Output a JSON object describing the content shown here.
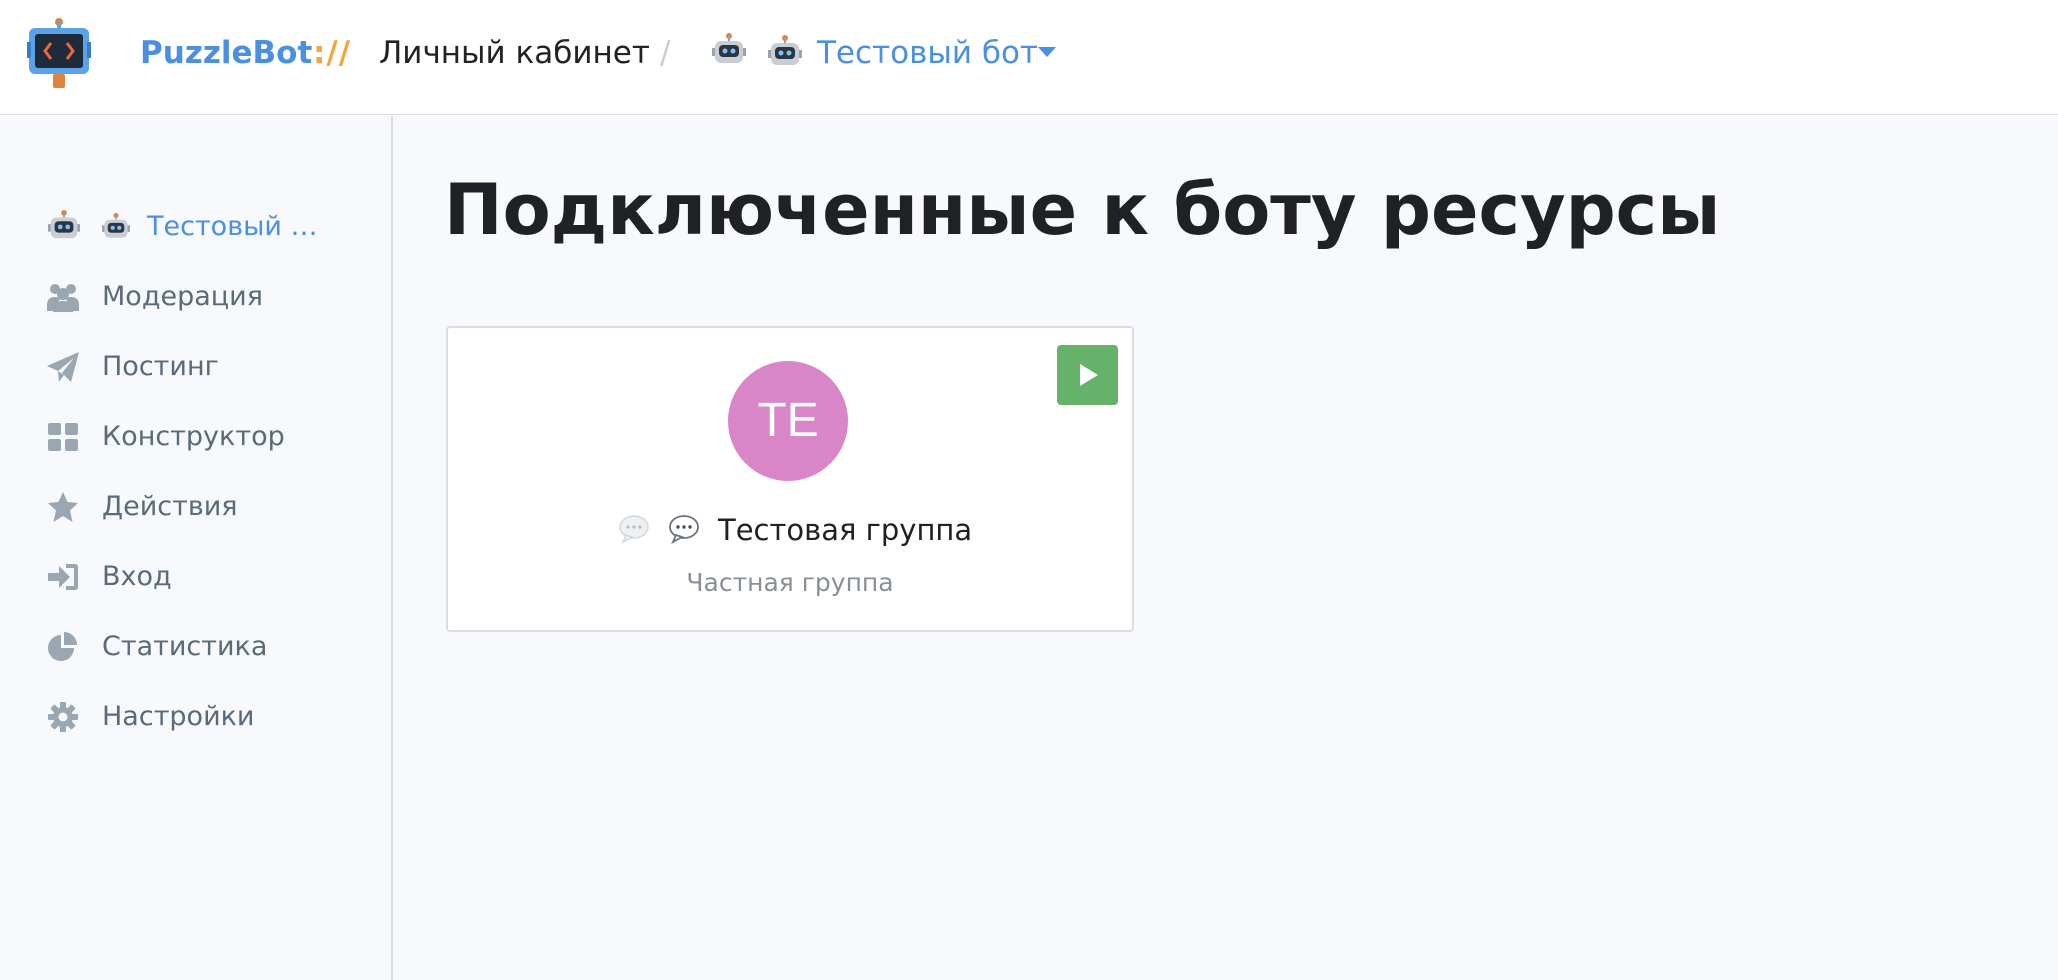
{
  "header": {
    "brand": "PuzzleBot",
    "separator": "://",
    "cabinet": "Личный кабинет",
    "crumb_sep": "/",
    "bot_name": "Тестовый бот"
  },
  "sidebar": {
    "active_bot": "Тестовый …",
    "items": [
      {
        "label": "Модерация",
        "icon": "users-icon"
      },
      {
        "label": "Постинг",
        "icon": "paper-plane-icon"
      },
      {
        "label": "Конструктор",
        "icon": "grid-icon"
      },
      {
        "label": "Действия",
        "icon": "star-icon"
      },
      {
        "label": "Вход",
        "icon": "sign-in-icon"
      },
      {
        "label": "Статистика",
        "icon": "pie-chart-icon"
      },
      {
        "label": "Настройки",
        "icon": "gear-icon"
      }
    ]
  },
  "main": {
    "title": "Подключенные к боту ресурсы",
    "resource": {
      "avatar_initials": "TE",
      "avatar_color": "#d986c9",
      "name": "Тестовая группа",
      "type": "Частная группа"
    }
  },
  "colors": {
    "accent": "#4a8fe2",
    "brand_separator": "#f3a43b",
    "play_button": "#67b26b",
    "sidebar_text": "#5b6a78"
  }
}
